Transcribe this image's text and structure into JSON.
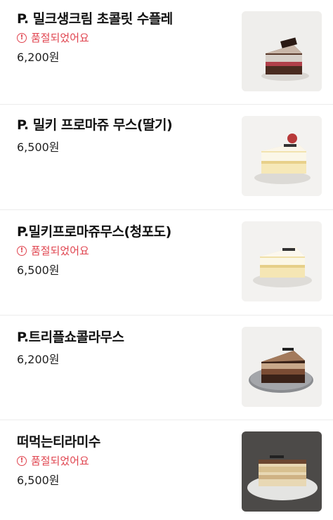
{
  "menu": {
    "items": [
      {
        "name": "P. 밀크생크림 초콜릿 수플레",
        "status": "품절되었어요",
        "price": "6,200원",
        "image": "chocolate-souffle-cake-photo"
      },
      {
        "name": "P. 밀키 프로마쥬 무스(딸기)",
        "status": "",
        "price": "6,500원",
        "image": "strawberry-fromage-mousse-photo"
      },
      {
        "name": "P.밀키프로마쥬무스(청포도)",
        "status": "품절되었어요",
        "price": "6,500원",
        "image": "green-grape-fromage-mousse-photo"
      },
      {
        "name": "P.트리플쇼콜라무스",
        "status": "",
        "price": "6,200원",
        "image": "triple-chocolat-mousse-photo"
      },
      {
        "name": "떠먹는티라미수",
        "status": "품절되었어요",
        "price": "6,500원",
        "image": "tiramisu-photo"
      }
    ]
  },
  "colors": {
    "soldout": "#e0444f",
    "divider": "#ececec"
  }
}
